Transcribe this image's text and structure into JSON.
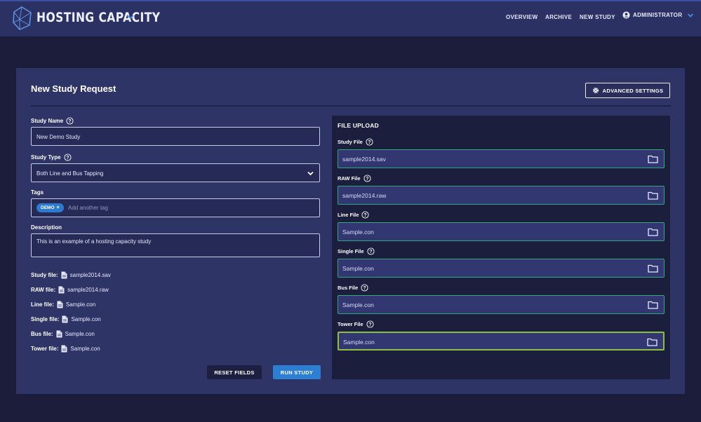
{
  "header": {
    "brand": "HOSTING CAPACITY",
    "nav": {
      "overview": "OVERVIEW",
      "archive": "ARCHIVE",
      "new_study": "NEW STUDY",
      "user": "ADMINISTRATOR"
    }
  },
  "colors": {
    "header_bg": "#2c3163",
    "page_bg": "#1b1d3b",
    "card_bg": "#2f3467",
    "primary": "#2d7fd3",
    "upload_border": "#2fa87e",
    "active_border": "#8fbf3f"
  },
  "card": {
    "title": "New Study Request",
    "advanced_settings": "ADVANCED SETTINGS"
  },
  "form": {
    "study_name": {
      "label": "Study Name",
      "value": "New Demo Study"
    },
    "study_type": {
      "label": "Study Type",
      "value": "Both Line and Bus Tapping"
    },
    "tags": {
      "label": "Tags",
      "chips": [
        "DEMO"
      ],
      "placeholder": "Add another tag"
    },
    "description": {
      "label": "Description",
      "value": "This is an example of a hosting capacity study"
    }
  },
  "file_summary": [
    {
      "key": "Study file:",
      "value": "sample2014.sav"
    },
    {
      "key": "RAW file:",
      "value": "sample2014.raw"
    },
    {
      "key": "Line file:",
      "value": "Sample.con"
    },
    {
      "key": "Single file:",
      "value": "Sample.con"
    },
    {
      "key": "Bus file:",
      "value": "Sample.con"
    },
    {
      "key": "Tower file:",
      "value": "Sample.con"
    }
  ],
  "buttons": {
    "reset": "RESET FIELDS",
    "run": "RUN STUDY"
  },
  "upload": {
    "title": "FILE UPLOAD",
    "fields": [
      {
        "label": "Study File",
        "value": "sample2014.sav"
      },
      {
        "label": "RAW File",
        "value": "sample2014.raw"
      },
      {
        "label": "Line File",
        "value": "Sample.con"
      },
      {
        "label": "Single File",
        "value": "Sample.con"
      },
      {
        "label": "Bus File",
        "value": "Sample.con"
      },
      {
        "label": "Tower File",
        "value": "Sample.con"
      }
    ]
  }
}
